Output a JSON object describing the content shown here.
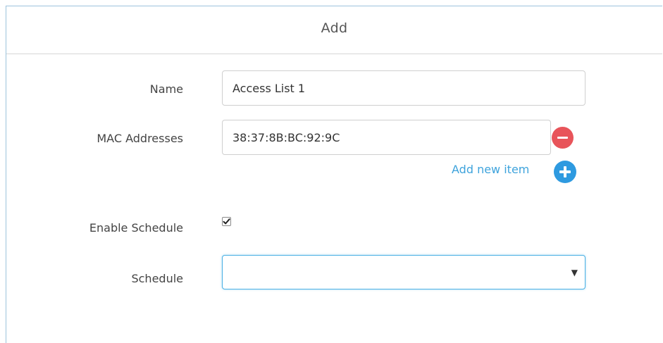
{
  "dialog": {
    "title": "Add"
  },
  "form": {
    "name": {
      "label": "Name",
      "value": "Access List 1"
    },
    "mac_addresses": {
      "label": "MAC Addresses",
      "items": [
        "38:37:8B:BC:92:9C"
      ],
      "add_new_label": "Add new item"
    },
    "enable_schedule": {
      "label": "Enable Schedule",
      "checked": true
    },
    "schedule": {
      "label": "Schedule",
      "selected": ""
    }
  },
  "icons": {
    "remove": "minus-circle-icon",
    "add": "plus-circle-icon",
    "caret": "caret-down-icon"
  },
  "colors": {
    "accent": "#3ea3dc",
    "remove": "#e8545a",
    "add": "#2e9ae0",
    "focus_border": "#4ab0e4"
  }
}
